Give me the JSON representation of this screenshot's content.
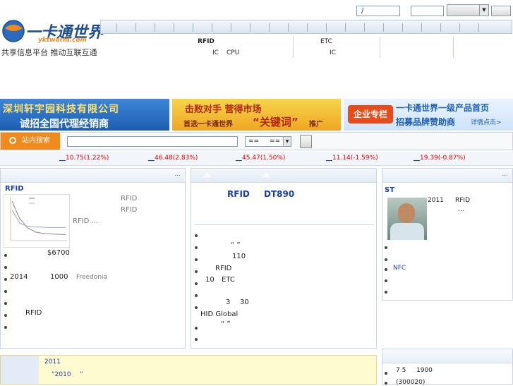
{
  "header": {
    "logo_text": "一卡通世界",
    "logo_url_text": "yktworld.com",
    "slogan": "共享信息平台  推动互联互通",
    "login_field_text": "/",
    "password_field_text": "",
    "select_value": ""
  },
  "subnav": {
    "col1_line1": "RFID",
    "col1_line2a": "IC",
    "col1_line2b": "CPU",
    "col2_line1": "ETC",
    "col2_line2": "IC"
  },
  "banners": {
    "b1_line1": "深圳轩宇园科技有限公司",
    "b1_line2": "诚招全国代理经销商",
    "b2_line1": "击败对手   营得市场",
    "b2_line2a": "首选一卡通世界",
    "b2_line2b": "“关键词”",
    "b2_line2c": "推广",
    "b3_tag": "企业专栏",
    "b3_line1": "一卡通世界一级产品首页",
    "b3_line2": "招募品牌赞助商",
    "b3_more": "详情点击>"
  },
  "search": {
    "button_label": "站内搜索",
    "query": "",
    "select1": "==",
    "select2": "=="
  },
  "ticker": [
    {
      "value": "10.75(1.22%)"
    },
    {
      "value": "46.48(2.83%)"
    },
    {
      "value": "45.47(1.50%)"
    },
    {
      "value": "11.14(-1.59%)"
    },
    {
      "value": "19.39(-0.87%)"
    }
  ],
  "left_panel": {
    "more": "...",
    "section_title": "RFID",
    "side_line1": "RFID",
    "side_line2": "RFID",
    "side_line3": "RFID ...",
    "item1": "$6700",
    "item3a": "2014",
    "item3b": "1000",
    "item3c": "Freedonia",
    "item6": "RFID"
  },
  "center_panel": {
    "headline_a": "RFID",
    "headline_b": "DT890",
    "item2": "“   ”",
    "item3": "110",
    "item4": "RFID",
    "item5a": "10",
    "item5b": "ETC",
    "item7a": "3",
    "item7b": "30",
    "item8": "HID Global",
    "item9": "“   ”"
  },
  "right_panel": {
    "more": "...",
    "title": "ST",
    "text1a": "2011",
    "text1b": "RFID",
    "text1c": "...",
    "item2": "NFC"
  },
  "bottom_left": {
    "line1": "2011",
    "line2a": "“2010",
    "line2b": "”"
  },
  "bottom_right": {
    "item1a": "7 5",
    "item1b": "1900",
    "item2": "(300020)"
  },
  "colors": {
    "orange": "#f08a1c",
    "link_blue": "#1a3fb0",
    "stock_red": "#dd0000",
    "banner_blue": "#2a6bbf"
  },
  "chart_data": {
    "type": "line",
    "series": [
      {
        "name": "",
        "values": [
          13,
          7,
          4,
          2.5,
          2,
          1.8,
          1.7,
          1.6
        ]
      },
      {
        "name": "",
        "values": [
          10,
          5.5,
          4.5,
          4.2,
          4.1,
          4,
          4,
          4
        ]
      }
    ],
    "ylim": [
      0,
      14
    ]
  }
}
